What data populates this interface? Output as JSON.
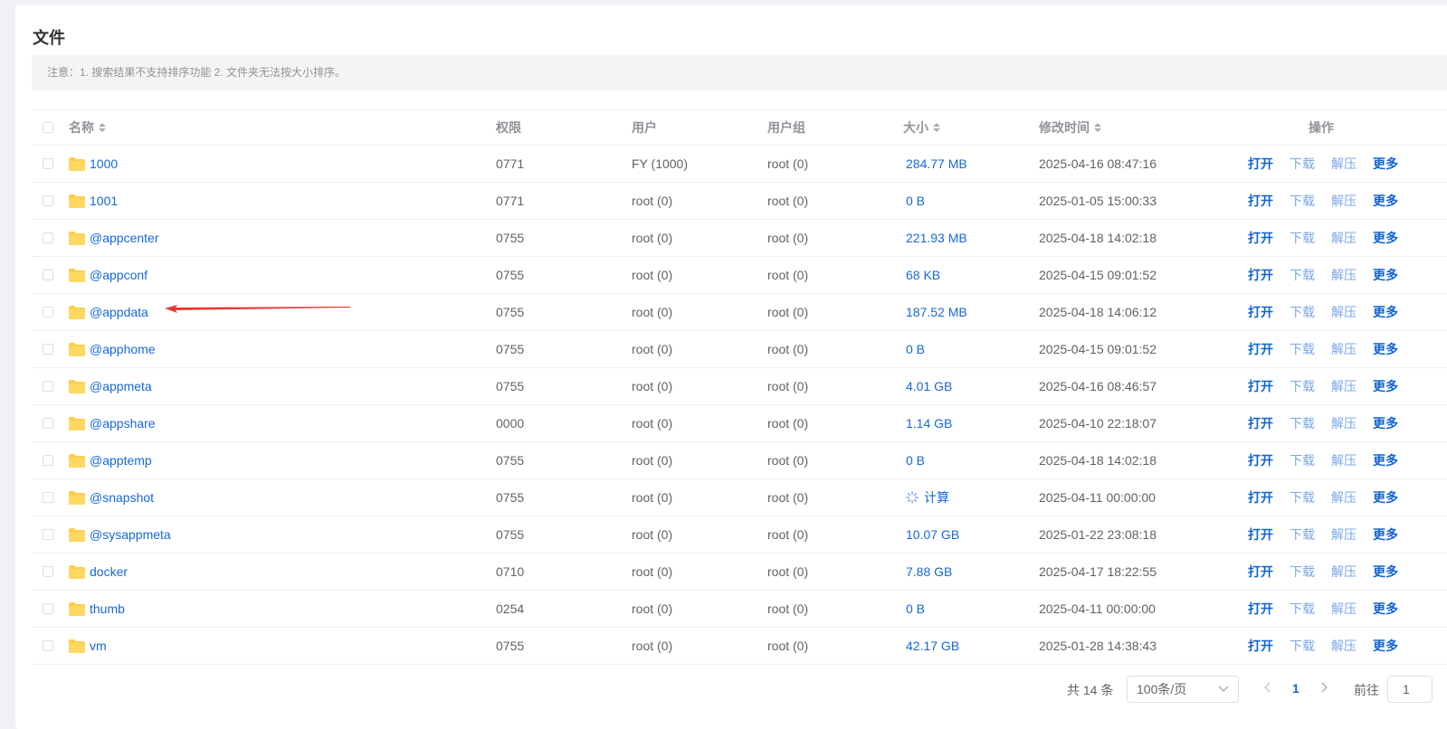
{
  "title": "文件",
  "notice": "注意：1. 搜索结果不支持排序功能 2. 文件夹无法按大小排序。",
  "columns": {
    "name": "名称",
    "perm": "权限",
    "user": "用户",
    "group": "用户组",
    "size": "大小",
    "mtime": "修改时间",
    "ops": "操作"
  },
  "actions": {
    "open": "打开",
    "download": "下载",
    "extract": "解压",
    "more": "更多"
  },
  "colors": {
    "link": "#1768d4",
    "folder": "#ffcd4a",
    "annotation_arrow": "#e53935"
  },
  "rows": [
    {
      "name": "1000",
      "perm": "0771",
      "user": "FY (1000)",
      "group": "root (0)",
      "size": "284.77 MB",
      "mtime": "2025-04-16 08:47:16"
    },
    {
      "name": "1001",
      "perm": "0771",
      "user": "root (0)",
      "group": "root (0)",
      "size": "0 B",
      "mtime": "2025-01-05 15:00:33"
    },
    {
      "name": "@appcenter",
      "perm": "0755",
      "user": "root (0)",
      "group": "root (0)",
      "size": "221.93 MB",
      "mtime": "2025-04-18 14:02:18"
    },
    {
      "name": "@appconf",
      "perm": "0755",
      "user": "root (0)",
      "group": "root (0)",
      "size": "68 KB",
      "mtime": "2025-04-15 09:01:52"
    },
    {
      "name": "@appdata",
      "perm": "0755",
      "user": "root (0)",
      "group": "root (0)",
      "size": "187.52 MB",
      "mtime": "2025-04-18 14:06:12"
    },
    {
      "name": "@apphome",
      "perm": "0755",
      "user": "root (0)",
      "group": "root (0)",
      "size": "0 B",
      "mtime": "2025-04-15 09:01:52"
    },
    {
      "name": "@appmeta",
      "perm": "0755",
      "user": "root (0)",
      "group": "root (0)",
      "size": "4.01 GB",
      "mtime": "2025-04-16 08:46:57"
    },
    {
      "name": "@appshare",
      "perm": "0000",
      "user": "root (0)",
      "group": "root (0)",
      "size": "1.14 GB",
      "mtime": "2025-04-10 22:18:07"
    },
    {
      "name": "@apptemp",
      "perm": "0755",
      "user": "root (0)",
      "group": "root (0)",
      "size": "0 B",
      "mtime": "2025-04-18 14:02:18"
    },
    {
      "name": "@snapshot",
      "perm": "0755",
      "user": "root (0)",
      "group": "root (0)",
      "size": "计算",
      "size_icon": "loading-spinner-icon",
      "mtime": "2025-04-11 00:00:00"
    },
    {
      "name": "@sysappmeta",
      "perm": "0755",
      "user": "root (0)",
      "group": "root (0)",
      "size": "10.07 GB",
      "mtime": "2025-01-22 23:08:18"
    },
    {
      "name": "docker",
      "perm": "0710",
      "user": "root (0)",
      "group": "root (0)",
      "size": "7.88 GB",
      "mtime": "2025-04-17 18:22:55"
    },
    {
      "name": "thumb",
      "perm": "0254",
      "user": "root (0)",
      "group": "root (0)",
      "size": "0 B",
      "mtime": "2025-04-11 00:00:00"
    },
    {
      "name": "vm",
      "perm": "0755",
      "user": "root (0)",
      "group": "root (0)",
      "size": "42.17 GB",
      "mtime": "2025-01-28 14:38:43"
    }
  ],
  "pagination": {
    "total": "共 14 条",
    "page_size": "100条/页",
    "current_page": "1",
    "goto_label": "前往",
    "goto_value": "1"
  }
}
